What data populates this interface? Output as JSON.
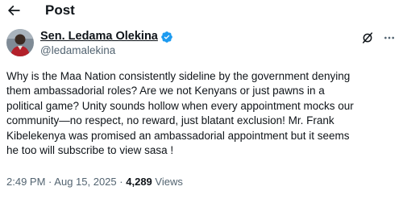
{
  "header": {
    "back_icon": "arrow-left-icon",
    "title": "Post"
  },
  "author": {
    "display_name": "Sen. Ledama Olekina",
    "handle": "@ledamalekina",
    "verified": true,
    "verified_color": "#1d9bf0"
  },
  "actions": {
    "grok_icon": "grok-icon",
    "more_icon": "more-horizontal-icon"
  },
  "tweet": {
    "lines": [
      "Why is the Maa Nation consistently sideline by the government denying",
      "them ambassadorial roles? Are we not Kenyans or just pawns in a",
      "political game? Unity sounds hollow when every appointment mocks our",
      "community—no respect, no reward, just blatant exclusion!  Mr. Frank",
      "Kibelekenya was promised an ambassadorial appointment but it seems",
      "he too will subscribe to view sasa !"
    ]
  },
  "meta": {
    "time": "2:49 PM",
    "separator": "·",
    "date": "Aug 15, 2025",
    "views_count": "4,289",
    "views_label": "Views"
  },
  "colors": {
    "text": "#0f1419",
    "secondary": "#536471",
    "accent": "#1d9bf0"
  }
}
